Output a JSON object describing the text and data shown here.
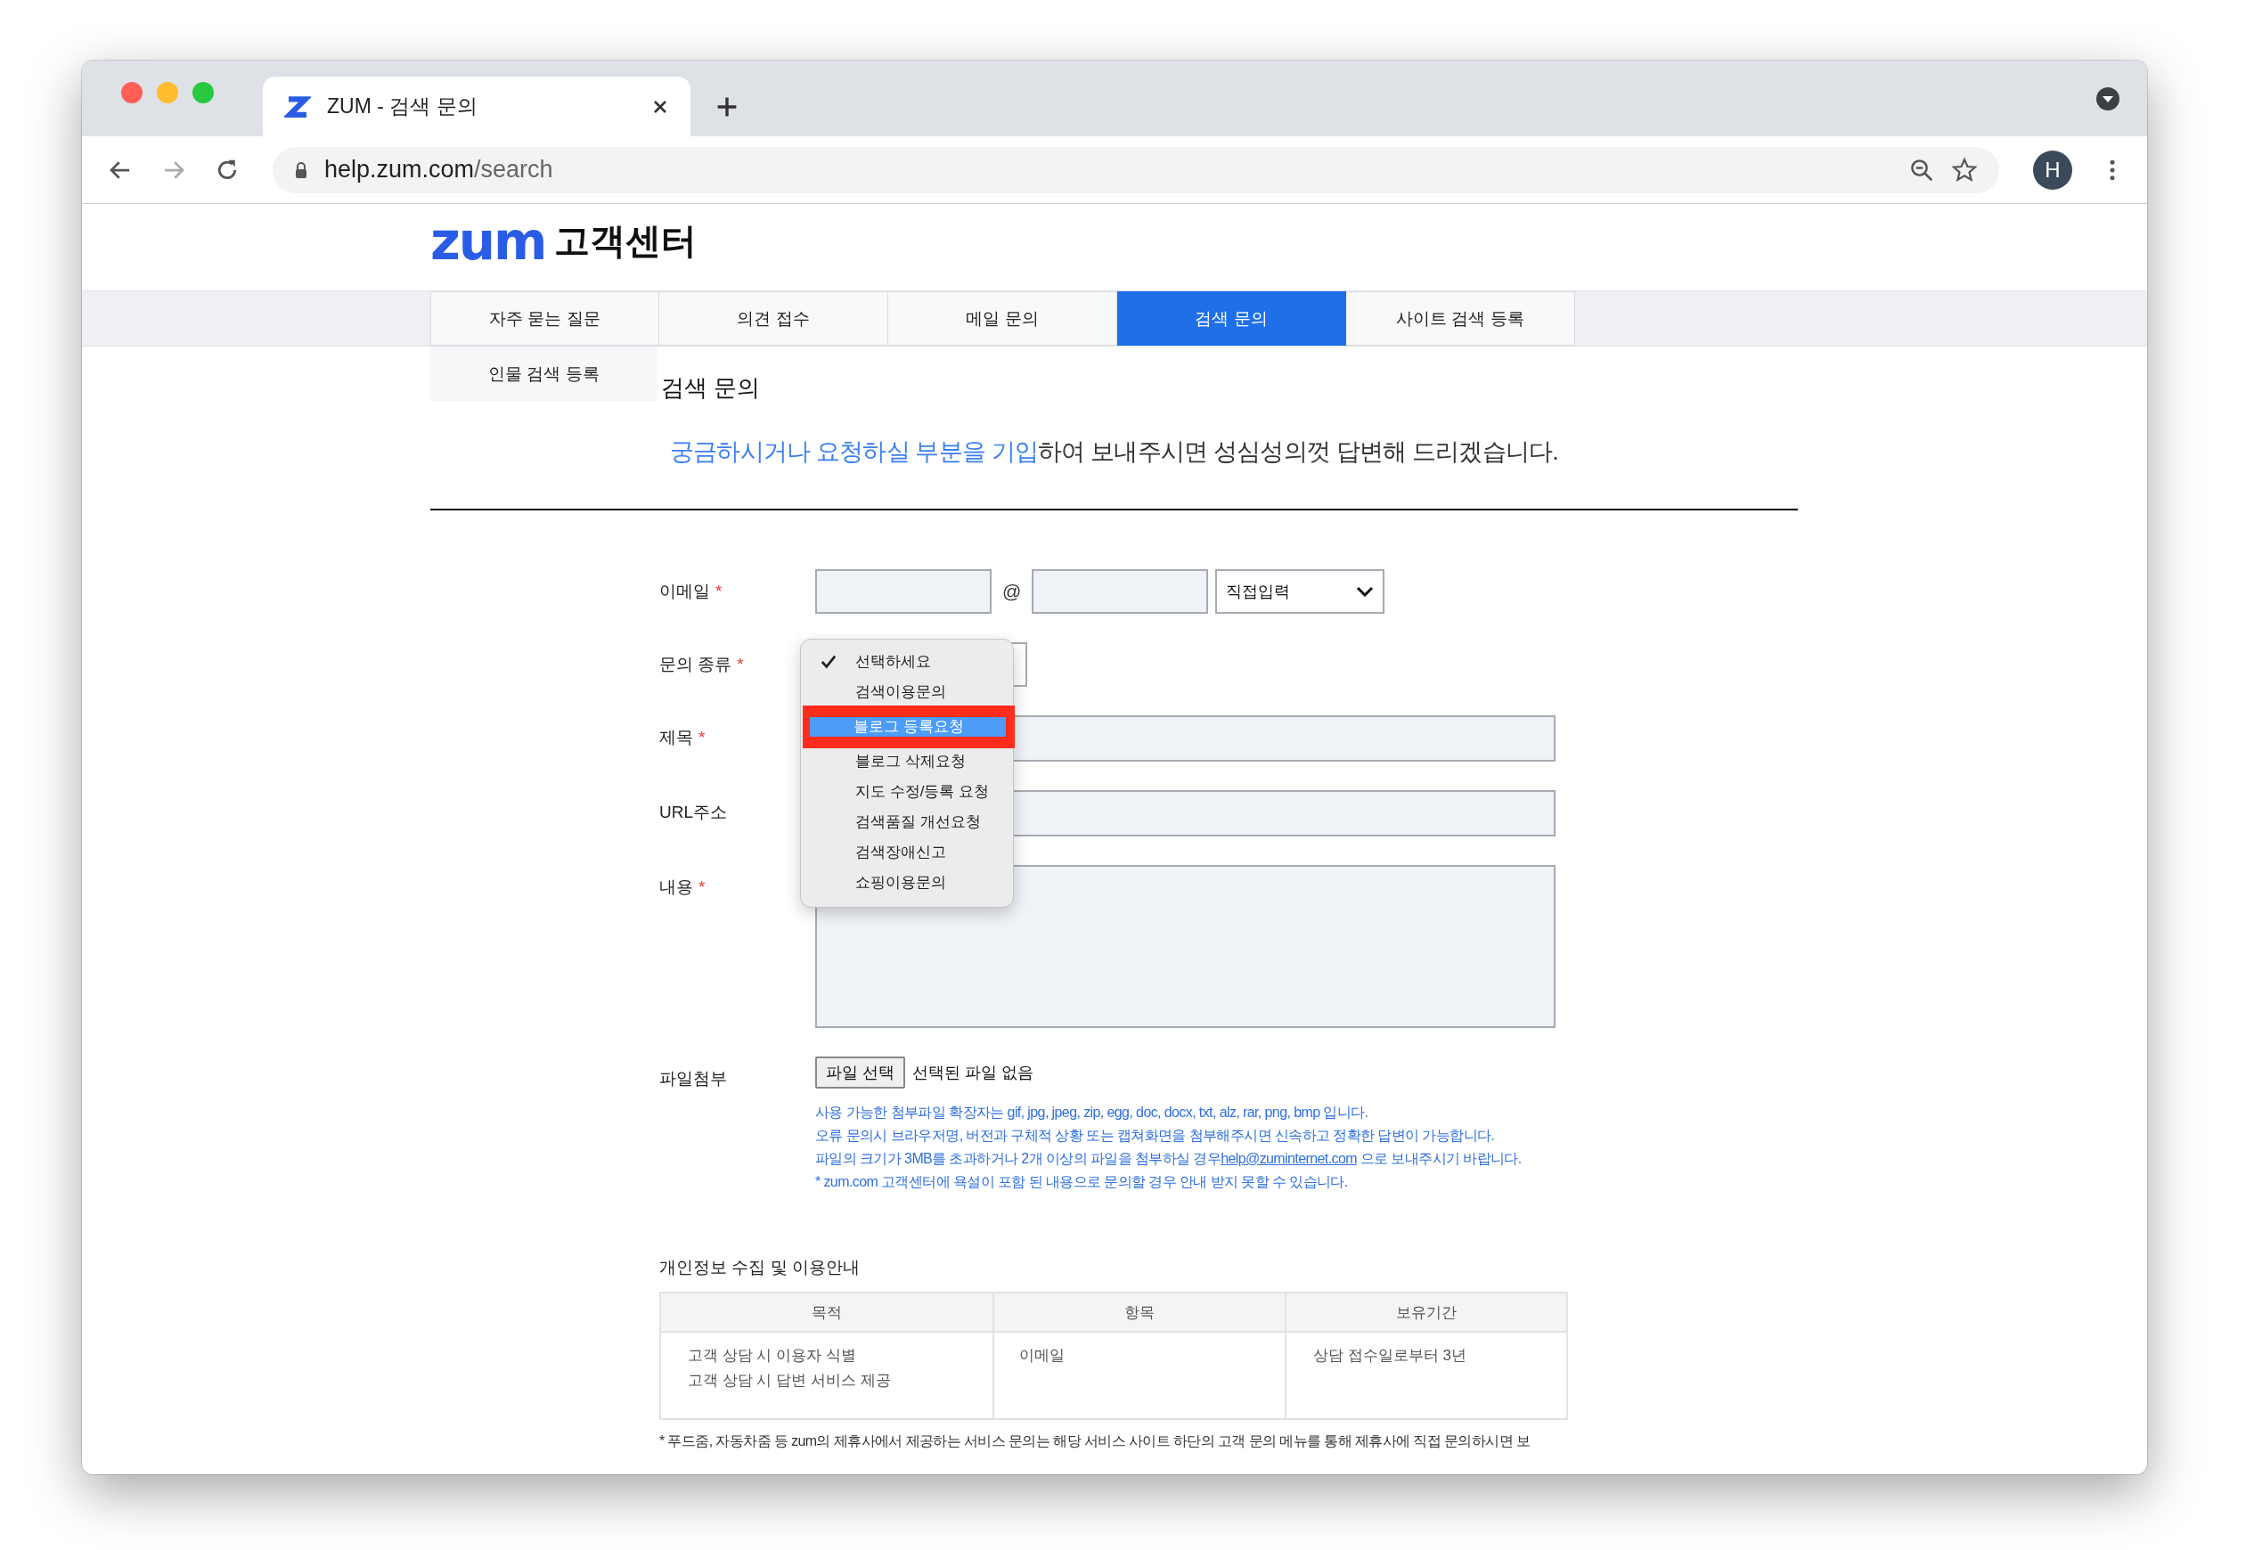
{
  "browser": {
    "tab_title": "ZUM - 검색 문의",
    "url_host": "help.zum.com",
    "url_path": "/search",
    "profile_initial": "H"
  },
  "header": {
    "logo": "zum",
    "title": "고객센터"
  },
  "nav_tabs": [
    {
      "label": "자주 묻는 질문",
      "selected": false
    },
    {
      "label": "의견 접수",
      "selected": false
    },
    {
      "label": "메일 문의",
      "selected": false
    },
    {
      "label": "검색 문의",
      "selected": true
    },
    {
      "label": "사이트 검색 등록",
      "selected": false
    },
    {
      "label": "인물 검색 등록",
      "selected": false
    }
  ],
  "page_title": "검색 문의",
  "intro": {
    "highlight": "궁금하시거나 요청하실 부분을 기입",
    "rest": "하여 보내주시면 성심성의껏 답변해 드리겠습니다."
  },
  "form": {
    "fields": [
      {
        "kind": "email",
        "label": "이메일",
        "mark": "*",
        "at": "@",
        "domain_select": "직접입력"
      },
      {
        "kind": "select",
        "label": "문의 종류",
        "mark": "*"
      },
      {
        "kind": "text",
        "label": "제목",
        "mark": "*"
      },
      {
        "kind": "text",
        "label": "URL주소"
      },
      {
        "kind": "textarea",
        "label": "내용",
        "mark": "*"
      },
      {
        "kind": "file",
        "label": "파일첨부",
        "button": "파일 선택",
        "status": "선택된 파일 없음"
      }
    ]
  },
  "dropdown": {
    "options": [
      {
        "label": "선택하세요",
        "checked": true,
        "selected": false,
        "annotated": false
      },
      {
        "label": "검색이용문의",
        "checked": false,
        "selected": false,
        "annotated": false
      },
      {
        "label": "블로그 등록요청",
        "checked": false,
        "selected": true,
        "annotated": true
      },
      {
        "label": "블로그 삭제요청",
        "checked": false,
        "selected": false,
        "annotated": false
      },
      {
        "label": "지도 수정/등록 요청",
        "checked": false,
        "selected": false,
        "annotated": false
      },
      {
        "label": "검색품질 개선요청",
        "checked": false,
        "selected": false,
        "annotated": false
      },
      {
        "label": "검색장애신고",
        "checked": false,
        "selected": false,
        "annotated": false
      },
      {
        "label": "쇼핑이용문의",
        "checked": false,
        "selected": false,
        "annotated": false
      }
    ]
  },
  "notes": [
    {
      "text": "사용 가능한 첨부파일 확장자는 gif, jpg, jpeg, zip, egg, doc, docx, txt, alz, rar, png, bmp 입니다."
    },
    {
      "text": "오류 문의시 브라우저명, 버전과 구체적 상황 또는 캡쳐화면을 첨부해주시면 신속하고 정확한 답변이 가능합니다."
    },
    {
      "text": "파일의 크기가 3MB를 초과하거나 2개 이상의 파일을 첨부하실 경우",
      "link": "help@zuminternet.com",
      "after": "으로 보내주시기 바랍니다."
    },
    {
      "text": " * zum.com 고객센터에 욕설이 포함 된 내용으로 문의할 경우 안내 받지 못할 수 있습니다."
    }
  ],
  "privacy": {
    "title": "개인정보 수집 및 이용안내",
    "columns": [
      "목적",
      "항목",
      "보유기간"
    ],
    "rows": [
      [
        [
          "고객 상담 시 이용자 식별",
          "고객 상담 시 답변 서비스 제공"
        ],
        [
          "이메일"
        ],
        [
          "상담 접수일로부터 3년"
        ]
      ]
    ]
  },
  "footer_note": "* 푸드줌, 자동차줌 등 zum의 제휴사에서 제공하는 서비스 문의는 해당 서비스 사이트 하단의 고객 문의 메뉴를 통해 제휴사에 직접 문의하시면 보"
}
